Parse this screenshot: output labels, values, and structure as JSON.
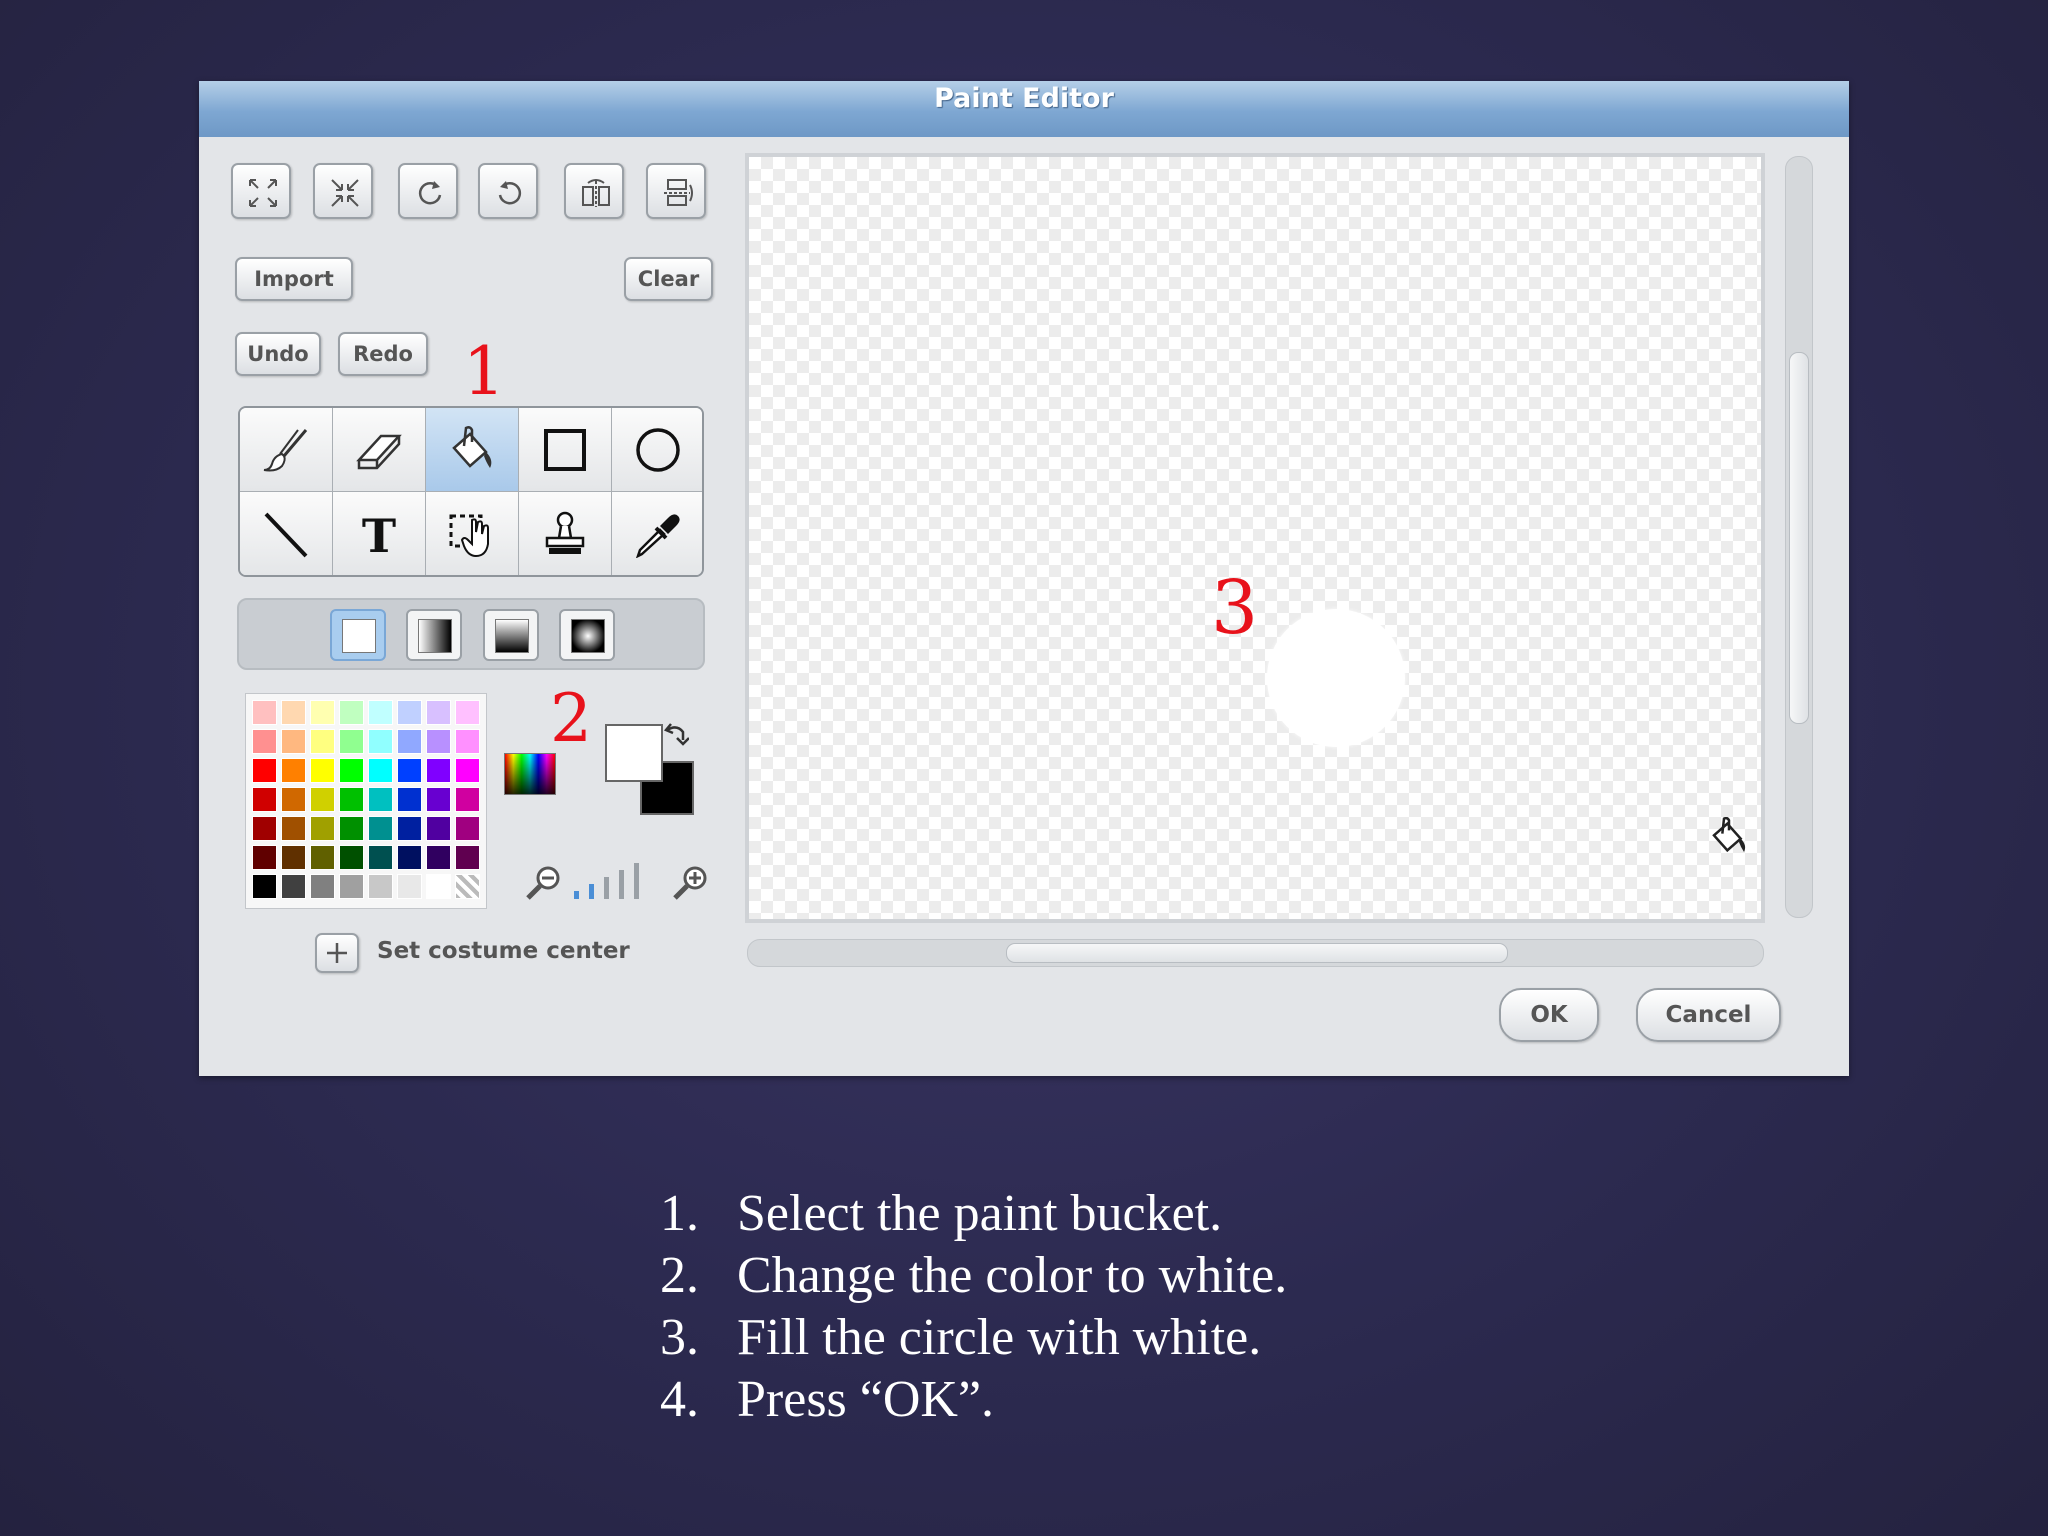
{
  "window": {
    "title": "Paint Editor"
  },
  "toolbar_top": {
    "icons": [
      "grow-icon",
      "shrink-icon",
      "rotate-left-icon",
      "rotate-right-icon",
      "flip-horizontal-icon",
      "flip-vertical-icon"
    ]
  },
  "buttons": {
    "import": "Import",
    "clear": "Clear",
    "undo": "Undo",
    "redo": "Redo",
    "ok": "OK",
    "cancel": "Cancel"
  },
  "tools": [
    {
      "name": "paintbrush-tool",
      "icon": "paintbrush-icon"
    },
    {
      "name": "eraser-tool",
      "icon": "eraser-icon"
    },
    {
      "name": "fill-tool",
      "icon": "paint-bucket-icon",
      "selected": true
    },
    {
      "name": "rectangle-tool",
      "icon": "rectangle-icon"
    },
    {
      "name": "ellipse-tool",
      "icon": "ellipse-icon"
    },
    {
      "name": "line-tool",
      "icon": "line-icon"
    },
    {
      "name": "text-tool",
      "icon": "text-icon",
      "glyph": "T"
    },
    {
      "name": "select-tool",
      "icon": "select-icon"
    },
    {
      "name": "stamp-tool",
      "icon": "stamp-icon"
    },
    {
      "name": "eyedropper-tool",
      "icon": "eyedropper-icon"
    }
  ],
  "fill_options": [
    "solid",
    "horizontal-gradient",
    "vertical-gradient",
    "radial-gradient"
  ],
  "colors": {
    "foreground": "#ffffff",
    "background": "#000000",
    "annotation": "#e8121b",
    "palette": [
      [
        "#ffc0c0",
        "#ffd8b0",
        "#ffffb0",
        "#c0ffc0",
        "#c0ffff",
        "#c0d0ff",
        "#d8c0ff",
        "#ffc0ff"
      ],
      [
        "#ff9090",
        "#ffb880",
        "#ffff80",
        "#90ff90",
        "#90ffff",
        "#90a8ff",
        "#b890ff",
        "#ff90ff"
      ],
      [
        "#ff0000",
        "#ff8000",
        "#ffff00",
        "#00ff00",
        "#00ffff",
        "#0040ff",
        "#8000ff",
        "#ff00ff"
      ],
      [
        "#d00000",
        "#d06800",
        "#d0d000",
        "#00c000",
        "#00c0c0",
        "#0030d0",
        "#6800d0",
        "#d000a0"
      ],
      [
        "#a00000",
        "#a05000",
        "#a0a000",
        "#009000",
        "#009090",
        "#0020a0",
        "#5000a0",
        "#a00080"
      ],
      [
        "#600000",
        "#603000",
        "#606000",
        "#005000",
        "#005050",
        "#001060",
        "#300060",
        "#600050"
      ],
      [
        "#000000",
        "#404040",
        "#808080",
        "#a0a0a0",
        "#c8c8c8",
        "#e8e8e8",
        "#ffffff",
        "checker"
      ]
    ]
  },
  "zoom_icons": [
    "zoom-out-icon",
    "zoom-in-icon"
  ],
  "zoom_level": 2,
  "zoom_levels_total": 5,
  "costume_center": {
    "label": "Set costume center"
  },
  "annotations": {
    "a1": "1",
    "a2": "2",
    "a3": "3"
  },
  "instructions": [
    {
      "num": "1.",
      "text": "Select the paint bucket."
    },
    {
      "num": "2.",
      "text": "Change the color to white."
    },
    {
      "num": "3.",
      "text": "Fill the circle with white."
    },
    {
      "num": "4.",
      "text": "Press “OK”."
    }
  ]
}
